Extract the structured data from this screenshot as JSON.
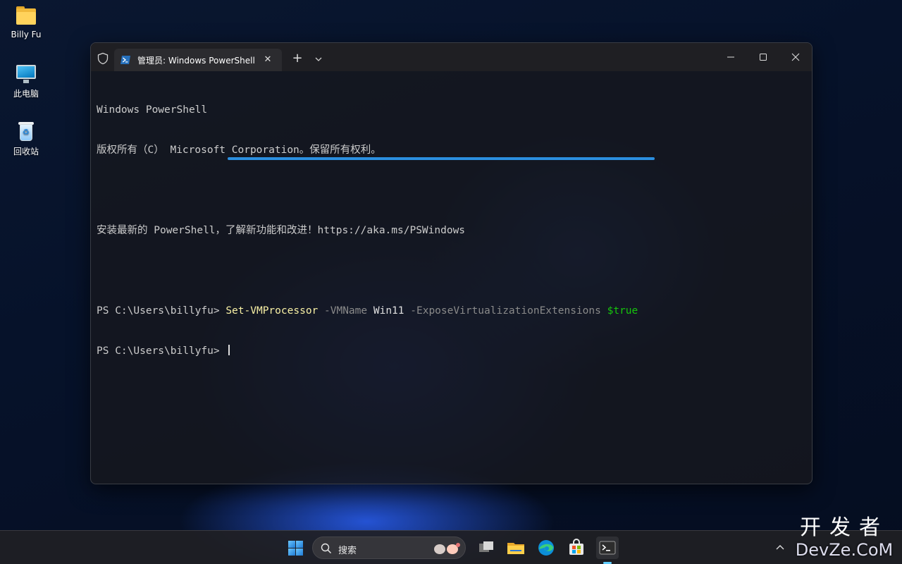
{
  "desktop": {
    "icons": [
      {
        "label": "Billy Fu",
        "icon": "folder-icon"
      },
      {
        "label": "此电脑",
        "icon": "computer-icon"
      },
      {
        "label": "回收站",
        "icon": "recycle-bin-icon"
      }
    ]
  },
  "window": {
    "tab_title": "管理员: Windows PowerShell",
    "buttons": {
      "new_tab": "+",
      "close_tab": "✕"
    }
  },
  "console": {
    "line1": "Windows PowerShell",
    "line2": "版权所有（C） Microsoft Corporation。保留所有权利。",
    "line3": "安装最新的 PowerShell，了解新功能和改进！https://aka.ms/PSWindows",
    "prompt": "PS C:\\Users\\billyfu> ",
    "command": {
      "cmdlet": "Set-VMProcessor",
      "param1": "-VMName",
      "arg1": "Win11",
      "param2": "-ExposeVirtualizationExtensions",
      "value": "$true"
    }
  },
  "taskbar": {
    "search_label": "搜索",
    "apps": [
      "windows-start-icon",
      "task-view-icon",
      "file-explorer-icon",
      "edge-icon",
      "store-icon",
      "terminal-icon"
    ]
  },
  "watermark": {
    "top": "开发者",
    "bottom": "DevZe.CoM"
  },
  "colors": {
    "accent": "#2b8fe0",
    "cmdlet": "#f9f1a5",
    "parameter": "#8a8a8a",
    "variable": "#16c60c"
  }
}
